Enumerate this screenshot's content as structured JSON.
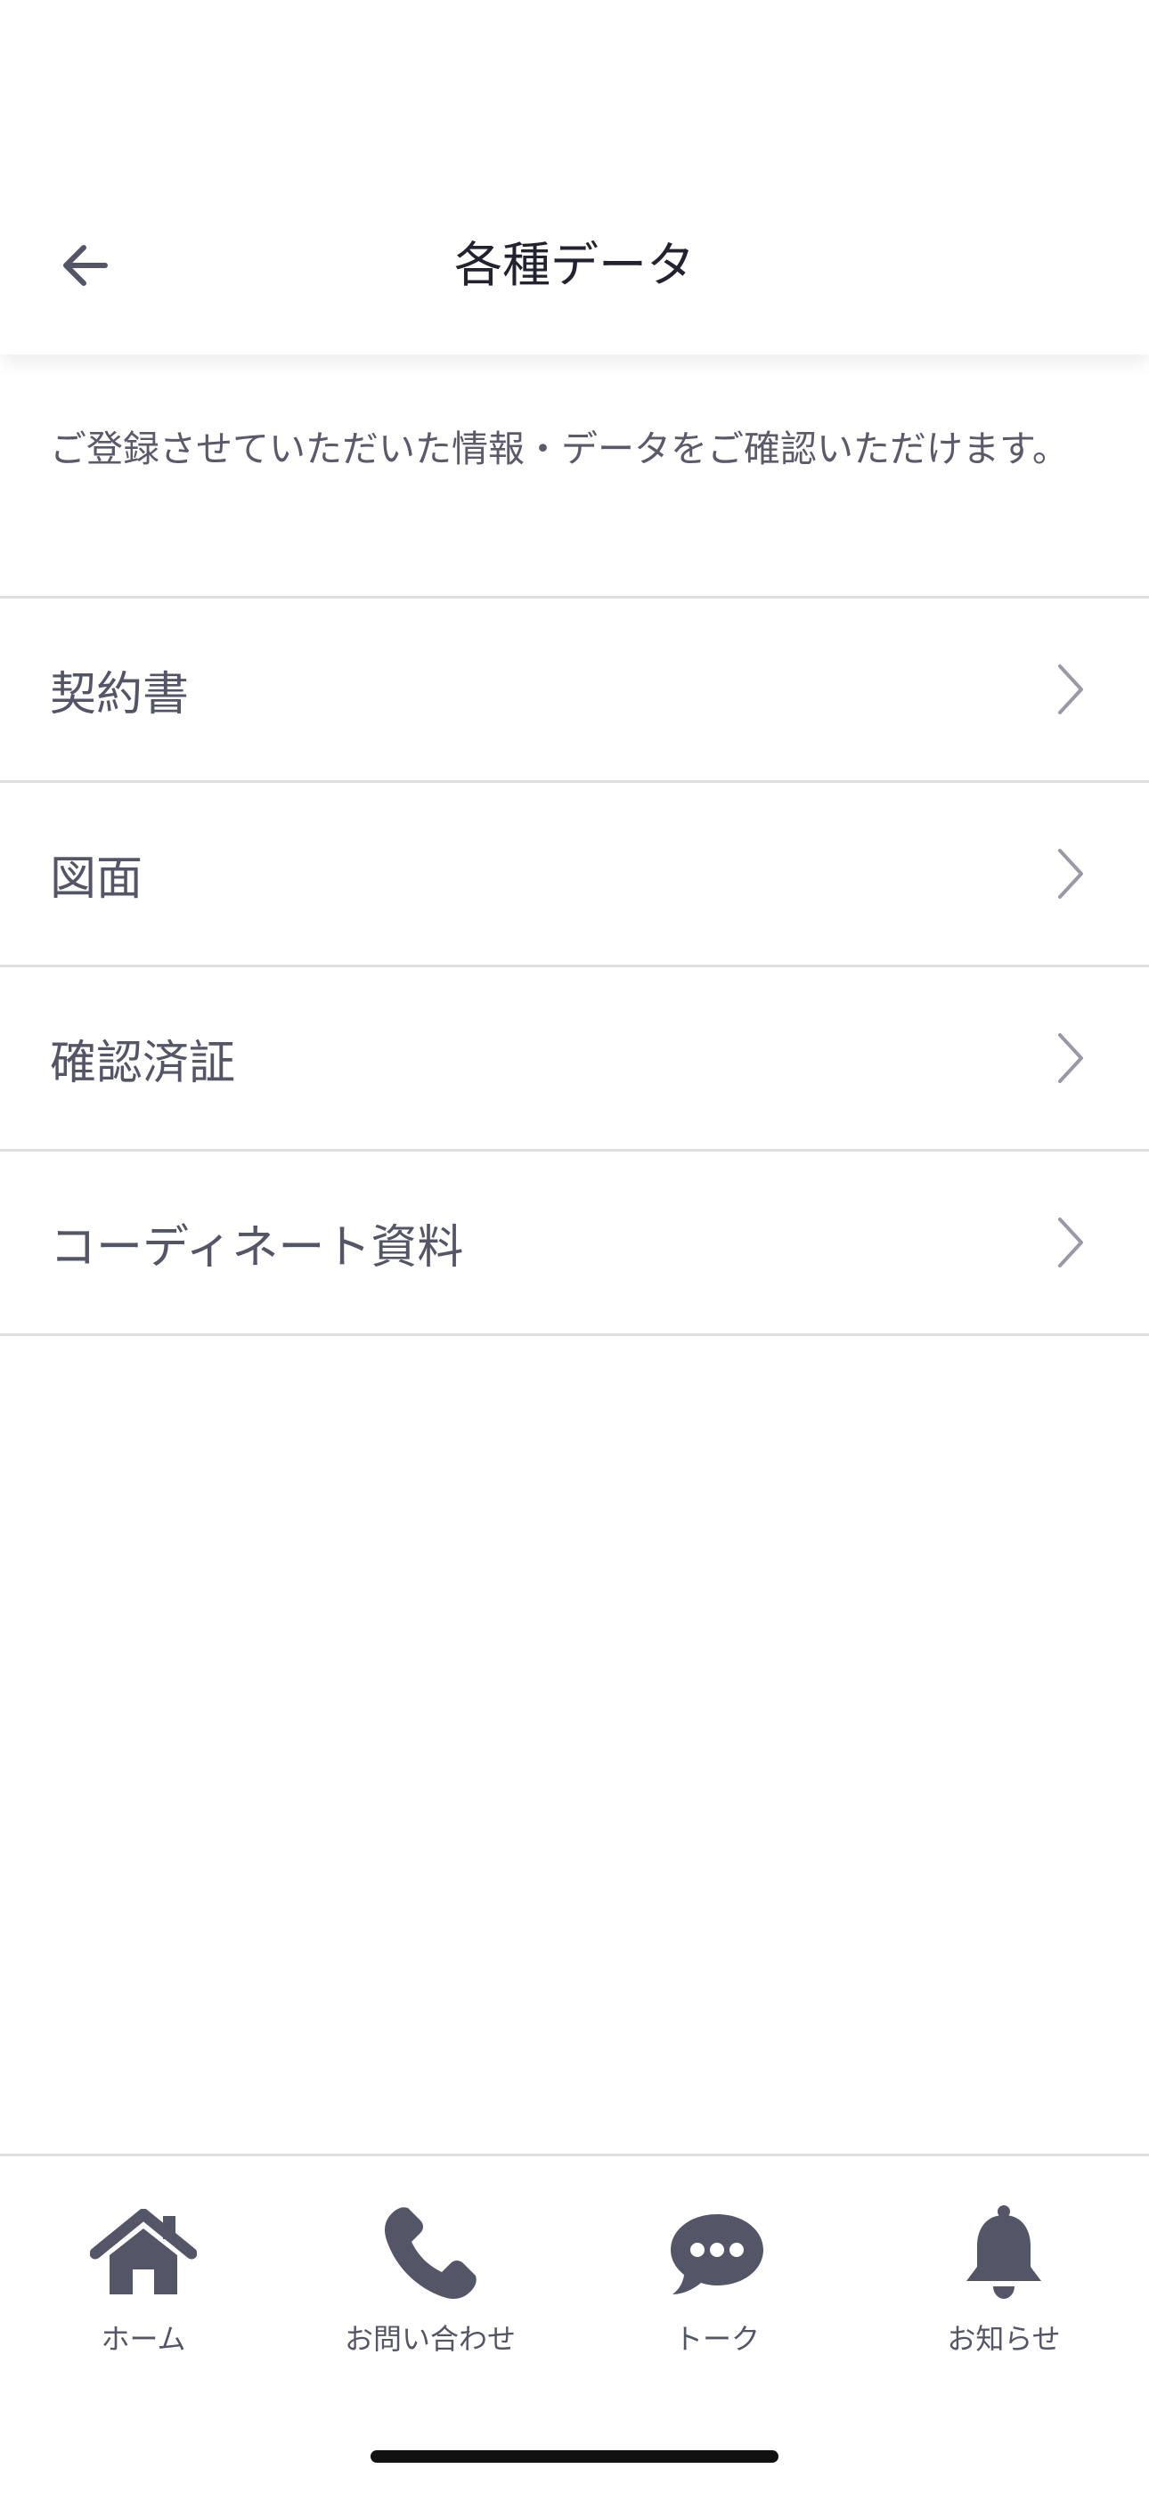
{
  "header": {
    "title": "各種データ",
    "back_icon": "arrow-left-icon"
  },
  "intro": {
    "text": "ご登録させていただいた情報・データをご確認いただけます。"
  },
  "menu": {
    "items": [
      {
        "label": "契約書",
        "icon": "chevron-right-icon"
      },
      {
        "label": "図面",
        "icon": "chevron-right-icon"
      },
      {
        "label": "確認済証",
        "icon": "chevron-right-icon"
      },
      {
        "label": "コーディネート資料",
        "icon": "chevron-right-icon"
      }
    ]
  },
  "tabbar": {
    "tabs": [
      {
        "label": "ホーム",
        "icon": "home-icon"
      },
      {
        "label": "お問い合わせ",
        "icon": "phone-icon"
      },
      {
        "label": "トーク",
        "icon": "chat-bubble-icon"
      },
      {
        "label": "お知らせ",
        "icon": "bell-icon"
      }
    ]
  },
  "colors": {
    "icon": "#555568",
    "divider": "#dedede",
    "title": "#222230",
    "chevron": "#9a9aa6"
  }
}
